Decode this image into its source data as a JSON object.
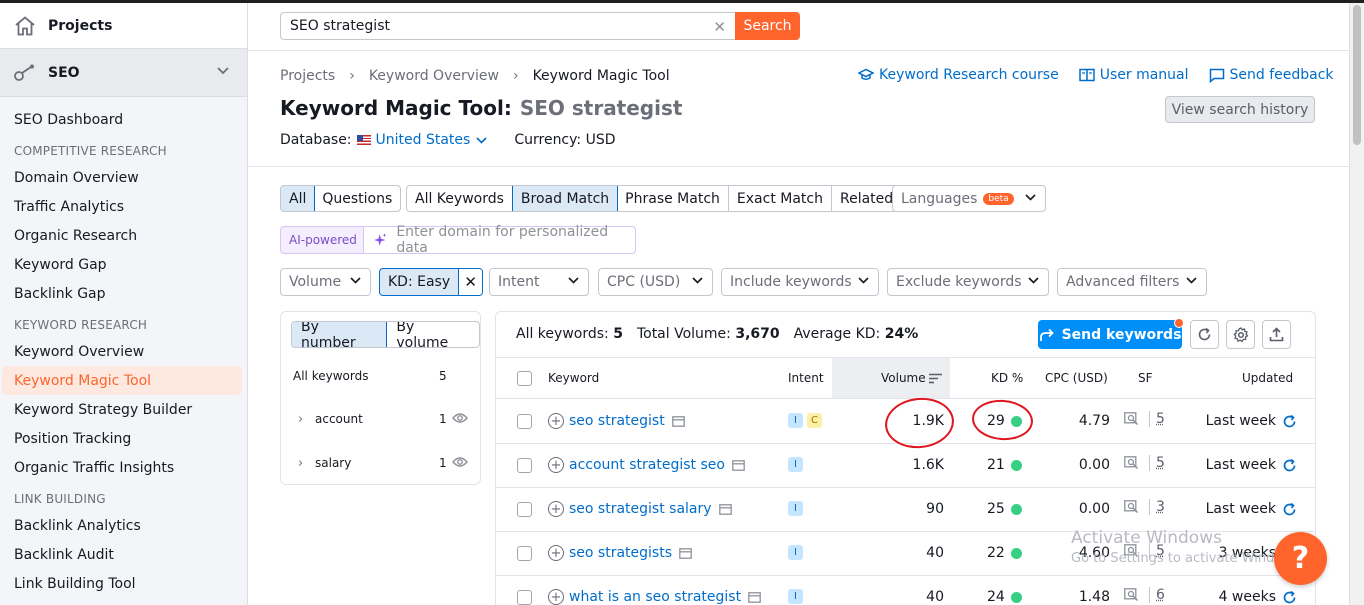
{
  "app": {
    "projects_label": "Projects",
    "seo_label": "SEO"
  },
  "sidebar": {
    "dashboard": "SEO Dashboard",
    "sections": [
      {
        "title": "COMPETITIVE RESEARCH",
        "items": [
          "Domain Overview",
          "Traffic Analytics",
          "Organic Research",
          "Keyword Gap",
          "Backlink Gap"
        ]
      },
      {
        "title": "KEYWORD RESEARCH",
        "items": [
          "Keyword Overview",
          "Keyword Magic Tool",
          "Keyword Strategy Builder",
          "Position Tracking",
          "Organic Traffic Insights"
        ]
      },
      {
        "title": "LINK BUILDING",
        "items": [
          "Backlink Analytics",
          "Backlink Audit",
          "Link Building Tool"
        ]
      }
    ],
    "active_item": "Keyword Magic Tool"
  },
  "search": {
    "value": "SEO strategist",
    "button": "Search"
  },
  "breadcrumb": [
    "Projects",
    "Keyword Overview",
    "Keyword Magic Tool"
  ],
  "top_links": [
    "Keyword Research course",
    "User manual",
    "Send feedback"
  ],
  "history_button": "View search history",
  "title": {
    "tool": "Keyword Magic Tool:",
    "query": "SEO strategist"
  },
  "database": {
    "label": "Database:",
    "value": "United States",
    "currency": "Currency: USD"
  },
  "filters": {
    "type_tabs": [
      "All",
      "Questions"
    ],
    "match_tabs": [
      "All Keywords",
      "Broad Match",
      "Phrase Match",
      "Exact Match",
      "Related"
    ],
    "languages": "Languages",
    "beta": "beta",
    "ai_label": "AI-powered",
    "ai_placeholder": "Enter domain for personalized data",
    "volume": "Volume",
    "kd": "KD: Easy",
    "intent": "Intent",
    "cpc": "CPC (USD)",
    "include": "Include keywords",
    "exclude": "Exclude keywords",
    "advanced": "Advanced filters"
  },
  "groups": {
    "tabs": [
      "By number",
      "By volume"
    ],
    "all_label": "All keywords",
    "all_count": "5",
    "items": [
      {
        "name": "account",
        "count": "1"
      },
      {
        "name": "salary",
        "count": "1"
      }
    ]
  },
  "table": {
    "stats": {
      "all_label": "All keywords:",
      "all_value": "5",
      "volume_label": "Total Volume:",
      "volume_value": "3,670",
      "kd_label": "Average KD:",
      "kd_value": "24%"
    },
    "send_button": "Send keywords",
    "headers": [
      "Keyword",
      "Intent",
      "Volume",
      "KD %",
      "CPC (USD)",
      "SF",
      "Updated"
    ],
    "rows": [
      {
        "keyword": "seo strategist",
        "intent": [
          "I",
          "C"
        ],
        "volume": "1.9K",
        "kd": "29",
        "kd_color": "#36d085",
        "cpc": "4.79",
        "sf": "5",
        "updated": "Last week"
      },
      {
        "keyword": "account strategist seo",
        "intent": [
          "I"
        ],
        "volume": "1.6K",
        "kd": "21",
        "kd_color": "#36d085",
        "cpc": "0.00",
        "sf": "5",
        "updated": "Last week"
      },
      {
        "keyword": "seo strategist salary",
        "intent": [
          "I"
        ],
        "volume": "90",
        "kd": "25",
        "kd_color": "#36d085",
        "cpc": "0.00",
        "sf": "3",
        "updated": "Last week"
      },
      {
        "keyword": "seo strategists",
        "intent": [
          "I"
        ],
        "volume": "40",
        "kd": "22",
        "kd_color": "#36d085",
        "cpc": "4.60",
        "sf": "5",
        "updated": "3 weeks"
      },
      {
        "keyword": "what is an seo strategist",
        "intent": [
          "I"
        ],
        "volume": "40",
        "kd": "24",
        "kd_color": "#36d085",
        "cpc": "1.48",
        "sf": "6",
        "updated": "4 weeks"
      }
    ]
  },
  "watermark": {
    "title": "Activate Windows",
    "subtitle": "Go to Settings to activate Windows."
  },
  "help": "?",
  "colors": {
    "accent": "#ff642d",
    "link": "#006dca",
    "primary_button": "#008ff8",
    "annotation": "#e0151e"
  }
}
